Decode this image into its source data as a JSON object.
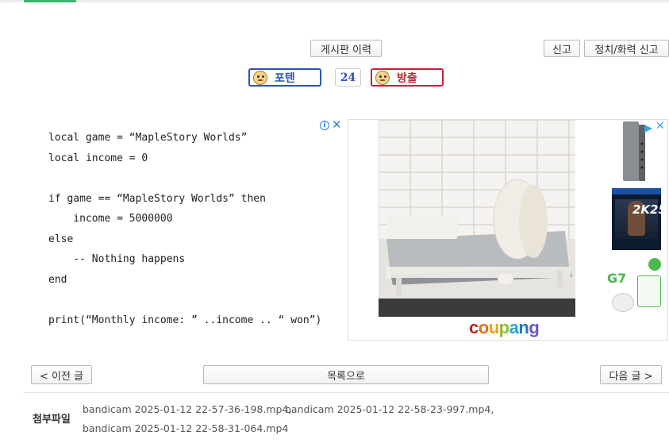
{
  "toolbar": {
    "history_button": "게시판 이력",
    "report_button": "신고",
    "political_report_button": "정치/화력 신고"
  },
  "votes": {
    "up_label": "포텐",
    "count": "24",
    "down_label": "방출"
  },
  "code_lines": [
    "local game = “MapleStory Worlds”",
    "local income = 0",
    "",
    "if game == “MapleStory Worlds” then",
    "    income = 5000000",
    "else",
    "    -- Nothing happens",
    "end",
    "",
    "print(“Monthly income: ” ..income .. “ won”)"
  ],
  "ad": {
    "brand": "coupang",
    "info_icon": "info-icon",
    "close_icon": "close-icon",
    "thumb2_label": "2K25",
    "thumb3_label": "G7"
  },
  "nav": {
    "prev_button": "< 이전 글",
    "list_button": "목록으로",
    "next_button": "다음 글 >"
  },
  "attachments": {
    "label": "첨부파일",
    "files": [
      "bandicam 2025-01-12 22-57-36-198.mp4,",
      "bandicam 2025-01-12 22-58-23-997.mp4,",
      "bandicam 2025-01-12 22-58-31-064.mp4"
    ]
  },
  "colors": {
    "accent_green": "#3cb371",
    "potent_blue": "#2b54b3",
    "release_red": "#c8203a"
  }
}
